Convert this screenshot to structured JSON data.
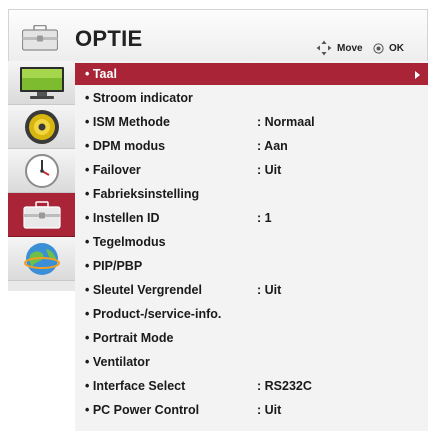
{
  "header": {
    "title": "OPTIE",
    "hint_move": "Move",
    "hint_ok": "OK"
  },
  "sidebar": {
    "categories": [
      {
        "name": "picture",
        "icon": "monitor-icon",
        "active": false
      },
      {
        "name": "audio",
        "icon": "speaker-icon",
        "active": false
      },
      {
        "name": "time",
        "icon": "clock-icon",
        "active": false
      },
      {
        "name": "option",
        "icon": "toolbox-icon",
        "active": true
      },
      {
        "name": "network",
        "icon": "globe-icon",
        "active": false
      }
    ]
  },
  "menu": {
    "items": [
      {
        "label": "• Taal",
        "value": "",
        "selected": true
      },
      {
        "label": "• Stroom indicator",
        "value": ""
      },
      {
        "label": "• ISM Methode",
        "value": ": Normaal"
      },
      {
        "label": "• DPM modus",
        "value": ": Aan"
      },
      {
        "label": "• Failover",
        "value": ": Uit"
      },
      {
        "label": "• Fabrieksinstelling",
        "value": ""
      },
      {
        "label": "• Instellen ID",
        "value": ": 1"
      },
      {
        "label": "• Tegelmodus",
        "value": ""
      },
      {
        "label": "• PIP/PBP",
        "value": ""
      },
      {
        "label": "• Sleutel Vergrendel",
        "value": ": Uit"
      },
      {
        "label": "• Product-/service-info.",
        "value": ""
      },
      {
        "label": "• Portrait Mode",
        "value": ""
      },
      {
        "label": "• Ventilator",
        "value": ""
      },
      {
        "label": "• Interface Select",
        "value": ": RS232C"
      },
      {
        "label": "• PC Power Control",
        "value": ": Uit"
      }
    ]
  },
  "colors": {
    "accent": "#a82436",
    "menu_bg": "#f3f3f3",
    "sidebar_bg": "#e9e9e9"
  }
}
